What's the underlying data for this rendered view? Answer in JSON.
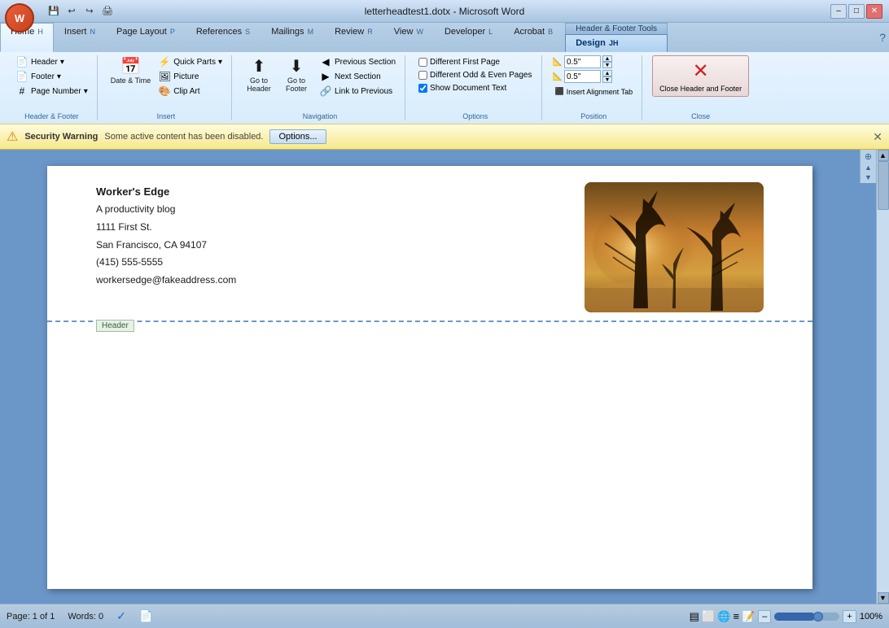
{
  "window": {
    "title": "letterheadtest1.dotx - Microsoft Word",
    "hf_tools": "Header & Footer Tools"
  },
  "title_bar": {
    "title": "letterheadtest1.dotx - Microsoft Word",
    "minimize": "–",
    "maximize": "□",
    "close": "✕"
  },
  "tabs": {
    "items": [
      "Home",
      "Insert",
      "Page Layout",
      "References",
      "Mailings",
      "Review",
      "View",
      "Developer",
      "Acrobat",
      "Design"
    ]
  },
  "ribbon": {
    "groups": {
      "header_footer": {
        "label": "Header & Footer",
        "header_btn": "Header",
        "footer_btn": "Footer",
        "page_number_btn": "Page Number"
      },
      "insert": {
        "label": "Insert",
        "date_time": "Date & Time",
        "quick_parts": "Quick Parts",
        "picture": "Picture",
        "clip_art": "Clip Art"
      },
      "navigation": {
        "label": "Navigation",
        "go_header": "Go to Header",
        "go_footer": "Go to Footer",
        "prev_section": "Previous Section",
        "next_section": "Next Section",
        "link_prev": "Link to Previous"
      },
      "options": {
        "label": "Options",
        "diff_first": "Different First Page",
        "diff_odd_even": "Different Odd & Even Pages",
        "show_doc_text": "Show Document Text"
      },
      "position": {
        "label": "Position",
        "header_pos": "0.5\"",
        "footer_pos": "0.5\""
      },
      "close": {
        "label": "Close",
        "close_btn": "Close Header and Footer",
        "close_x": "✕"
      }
    }
  },
  "security": {
    "title": "Security Warning",
    "message": "Some active content has been disabled.",
    "options_btn": "Options...",
    "icon": "⚠"
  },
  "document": {
    "company_name": "Worker's Edge",
    "tagline": "A productivity blog",
    "address": "1111 First St.",
    "city": "San Francisco, CA 94107",
    "phone": "(415) 555-5555",
    "email": "workersedge@fakeaddress.com",
    "header_label": "Header"
  },
  "status_bar": {
    "page": "Page: 1 of 1",
    "words": "Words: 0",
    "zoom": "100%",
    "zoom_minus": "–",
    "zoom_plus": "+"
  }
}
